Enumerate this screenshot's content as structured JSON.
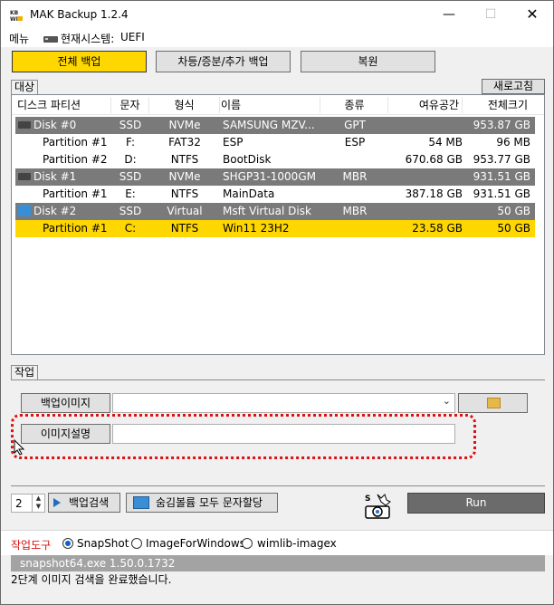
{
  "window": {
    "title": "MAK Backup 1.2.4",
    "icon_label": "KB\nWP"
  },
  "menubar": {
    "menu": "메뉴",
    "system_label": "현재시스템:",
    "system_value": "UEFI"
  },
  "tabs": {
    "full_backup": "전체 백업",
    "diff_backup": "차등/증분/추가 백업",
    "restore": "복원"
  },
  "target": {
    "group_label": "대상",
    "refresh": "새로고침"
  },
  "table": {
    "headers": [
      "디스크 파티션",
      "문자",
      "형식",
      "이름",
      "종류",
      "여유공간",
      "전체크기"
    ],
    "rows": [
      {
        "kind": "disk",
        "name": "Disk #0",
        "drive": "SSD",
        "type": "NVMe",
        "label": "SAMSUNG MZV...",
        "scheme": "GPT",
        "free": "",
        "total": "953.87 GB"
      },
      {
        "kind": "part",
        "name": "Partition #1",
        "drive": "F:",
        "type": "FAT32",
        "label": "ESP",
        "scheme": "ESP",
        "free": "54 MB",
        "total": "96 MB"
      },
      {
        "kind": "part",
        "name": "Partition #2",
        "drive": "D:",
        "type": "NTFS",
        "label": "BootDisk",
        "scheme": "",
        "free": "670.68 GB",
        "total": "953.77 GB"
      },
      {
        "kind": "disk",
        "name": "Disk #1",
        "drive": "SSD",
        "type": "NVMe",
        "label": "SHGP31-1000GM",
        "scheme": "MBR",
        "free": "",
        "total": "931.51 GB"
      },
      {
        "kind": "part",
        "name": "Partition #1",
        "drive": "E:",
        "type": "NTFS",
        "label": "MainData",
        "scheme": "",
        "free": "387.18 GB",
        "total": "931.51 GB"
      },
      {
        "kind": "vdisk",
        "name": "Disk #2",
        "drive": "SSD",
        "type": "Virtual",
        "label": "Msft Virtual Disk",
        "scheme": "MBR",
        "free": "",
        "total": "50 GB"
      },
      {
        "kind": "sel",
        "name": "Partition #1",
        "drive": "C:",
        "type": "NTFS",
        "label": "Win11 23H2",
        "scheme": "",
        "free": "23.58 GB",
        "total": "50 GB"
      }
    ]
  },
  "work": {
    "group_label": "작업",
    "image_button": "백업이미지",
    "image_value": "",
    "desc_button": "이미지설명",
    "desc_value": ""
  },
  "controls": {
    "spin_value": "2",
    "search_button": "백업검색",
    "assign_button": "숨김볼륨 모두 문자할당",
    "run_button": "Run"
  },
  "tools": {
    "label": "작업도구",
    "options": [
      "SnapShot",
      "ImageForWindows",
      "wimlib-imagex"
    ],
    "selected": "SnapShot"
  },
  "status": {
    "line1": "snapshot64.exe 1.50.0.1732",
    "line2": "2단계 이미지 검색을 완료했습니다."
  },
  "colors": {
    "accent": "#ffd700",
    "disk_row": "#7a7a7a",
    "highlight": "#dd1111"
  }
}
